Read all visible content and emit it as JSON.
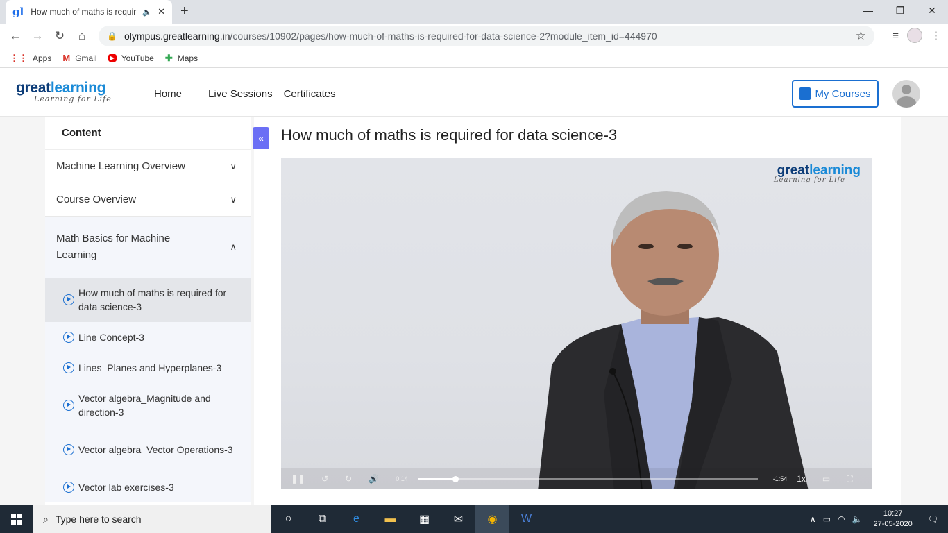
{
  "browser": {
    "tab_title": "How much of maths is requir",
    "favicon_letter": "gl",
    "url_host": "olympus.greatlearning.in",
    "url_path": "/courses/10902/pages/how-much-of-maths-is-required-for-data-science-2?module_item_id=444970",
    "window_controls": [
      "—",
      "❐",
      "✕"
    ]
  },
  "bookmarks": [
    {
      "label": "Apps",
      "icon": "apps-grid-icon"
    },
    {
      "label": "Gmail",
      "icon": "gmail-icon"
    },
    {
      "label": "YouTube",
      "icon": "youtube-icon"
    },
    {
      "label": "Maps",
      "icon": "maps-icon"
    }
  ],
  "site": {
    "logo_main": "great",
    "logo_accent": "learning",
    "logo_tagline": "Learning for Life",
    "nav": [
      "Home",
      "Live Sessions",
      "Certificates"
    ],
    "my_courses": "My Courses"
  },
  "sidebar": {
    "title": "Content",
    "sections": [
      {
        "label": "Machine Learning Overview",
        "expanded": false
      },
      {
        "label": "Course Overview",
        "expanded": false
      }
    ],
    "open_section": {
      "label": "Math Basics for Machine Learning",
      "items": [
        "How much of maths is required for data science-3",
        "Line Concept-3",
        "Lines_Planes and Hyperplanes-3",
        "Vector algebra_Magnitude and direction-3",
        "Vector algebra_Vector Operations-3",
        "Vector lab exercises-3"
      ],
      "active_index": 0
    },
    "collapse_glyph": "«"
  },
  "lesson": {
    "title": "How much of maths is required for data science-3"
  },
  "video": {
    "logo_main": "great",
    "logo_accent": "learning",
    "logo_tagline": "Learning for Life",
    "current_time": "0:14",
    "remaining_time": "-1:54",
    "speed": "1x",
    "progress": 0.11
  },
  "taskbar": {
    "search_placeholder": "Type here to search",
    "time": "10:27",
    "date": "27-05-2020"
  },
  "colors": {
    "accent": "#1a6fd1",
    "collapse_button": "#6b6ff5",
    "taskbar": "#1f2a36"
  }
}
